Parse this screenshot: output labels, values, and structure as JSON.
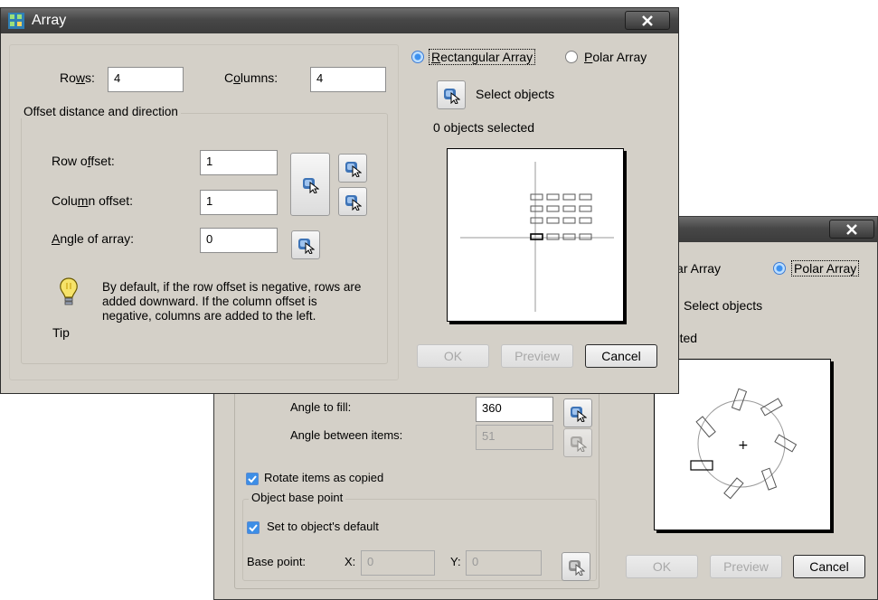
{
  "back_dialog": {
    "title": "",
    "tab_rect_label": "Rectangular Array",
    "tab_polar_label": "Polar Array",
    "select_objects_label": "Select objects",
    "objects_selected_label": "0 objects selected",
    "angle_to_fill_label": "Angle to fill:",
    "angle_to_fill_value": "360",
    "angle_between_label": "Angle between items:",
    "angle_between_value": "51",
    "rotate_items_label": "Rotate items as copied",
    "rotate_items_checked": true,
    "base_group_label": "Object base point",
    "set_default_label": "Set to object's default",
    "set_default_checked": true,
    "base_point_label": "Base point:",
    "x_label": "X:",
    "x_value": "0",
    "y_label": "Y:",
    "y_value": "0",
    "ok_label": "OK",
    "preview_label": "Preview",
    "cancel_label": "Cancel",
    "selected_mode": "polar"
  },
  "front_dialog": {
    "title": "Array",
    "rows_label": "Rows:",
    "rows_value": "4",
    "columns_label": "Columns:",
    "columns_value": "4",
    "offset_group_label": "Offset distance and direction",
    "row_offset_label": "Row offset:",
    "row_offset_value": "1",
    "column_offset_label": "Column offset:",
    "column_offset_value": "1",
    "angle_label": "Angle of array:",
    "angle_value": "0",
    "tip_text": "By default, if the row offset is negative, rows are added downward.  If the column offset is negative, columns are added to the left.",
    "tip_label": "Tip",
    "tab_rect_label": "Rectangular Array",
    "tab_polar_label": "Polar Array",
    "select_objects_label": "Select objects",
    "objects_selected_label": "0 objects selected",
    "ok_label": "OK",
    "preview_label": "Preview",
    "cancel_label": "Cancel",
    "selected_mode": "rectangular"
  },
  "icons": {
    "pick": "pick-point-icon",
    "tip": "lightbulb-icon",
    "close": "close-icon",
    "app": "array-app-icon"
  },
  "colors": {
    "title_bar": "#474747",
    "dialog_bg": "#d4d0c8",
    "radio_selected": "#3d91f0"
  }
}
